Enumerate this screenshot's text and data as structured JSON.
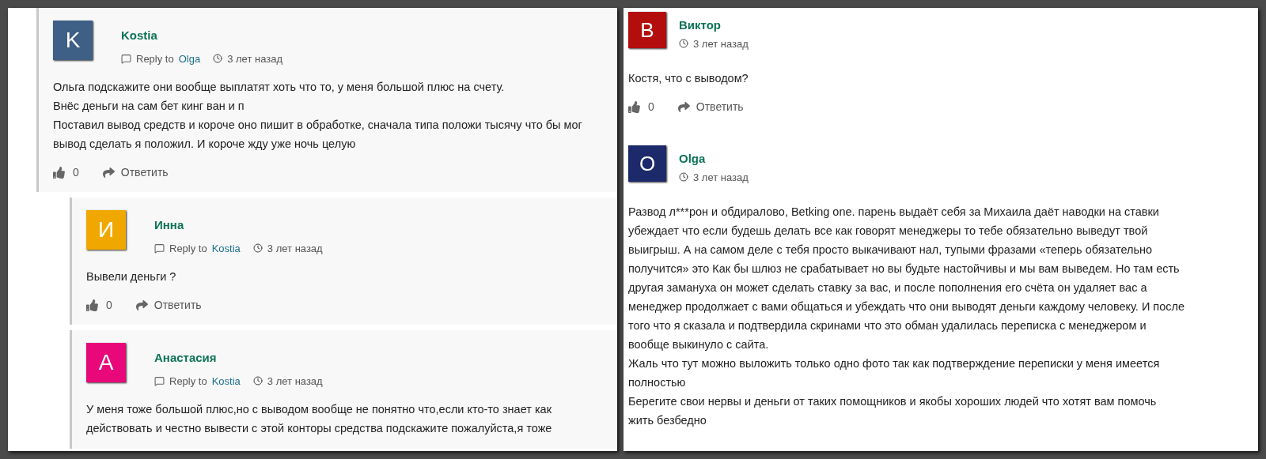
{
  "left_panel": {
    "comments": [
      {
        "author": "Kostia",
        "avatar_letter": "K",
        "color": "#3e5f86",
        "reply_label": "Reply to",
        "reply_to": "Olga",
        "time": "3 лет назад",
        "lines": [
          "Ольга подскажите они вообще выплатят хоть что то, у меня большой плюс на счету.",
          "Внёс деньги на сам бет кинг ван и п",
          "Поставил вывод средств и короче оно пишит в обработке, сначала типа положи тысячу что бы мог",
          "вывод сделать я положил. И короче жду уже ночь целую"
        ],
        "likes": "0",
        "reply_button": "Ответить",
        "children": [
          {
            "author": "Инна",
            "avatar_letter": "И",
            "color": "#f0a800",
            "reply_label": "Reply to",
            "reply_to": "Kostia",
            "time": "3 лет назад",
            "lines": [
              "Вывели деньги ?"
            ],
            "likes": "0",
            "reply_button": "Ответить"
          },
          {
            "author": "Анастасия",
            "avatar_letter": "А",
            "color": "#e8087a",
            "reply_label": "Reply to",
            "reply_to": "Kostia",
            "time": "3 лет назад",
            "lines": [
              "У меня тоже большой плюс,но с выводом вообще не понятно что,если кто-то знает как",
              "действовать и честно вывести с этой конторы средства подскажите пожалуйста,я тоже"
            ]
          }
        ]
      }
    ]
  },
  "right_panel": {
    "comments": [
      {
        "author": "Виктор",
        "avatar_letter": "B",
        "color": "#b30d0d",
        "time": "3 лет назад",
        "lines": [
          "Костя, что с выводом?"
        ],
        "likes": "0",
        "reply_button": "Ответить"
      },
      {
        "author": "Olga",
        "avatar_letter": "O",
        "color": "#1c2a6b",
        "time": "3 лет назад",
        "lines": [
          "Развод л***рон и обдиралово, Betking one. парень выдаёт себя за Михаила даёт наводки на ставки",
          "убеждает что если будешь делать все как говорят менеджеры то тебе обязательно выведут твой",
          "выигрыш. А на самом деле с тебя просто выкачивают нал, тупыми фразами «теперь обязательно",
          "получится» это Как бы шлюз не срабатывает но вы будьте настойчивы и мы вам выведем. Но там есть",
          "другая замануха он может сделать ставку за вас, и после пополнения его счёта он удаляет вас а",
          "менеджер продолжает с вами общаться и убеждать что они выводят деньги каждому человеку. И после",
          "того что я сказала и подтвердила скринами что это обман удалилась переписка с менеджером и",
          "вообще выкинуло с сайта.",
          "Жаль что тут можно выложить только одно фото так как подтверждение переписки у меня имеется",
          "полностью",
          "Берегите свои нервы и деньги от таких помощников и якобы хороших людей что хотят вам помочь",
          "жить безбедно"
        ]
      }
    ]
  }
}
